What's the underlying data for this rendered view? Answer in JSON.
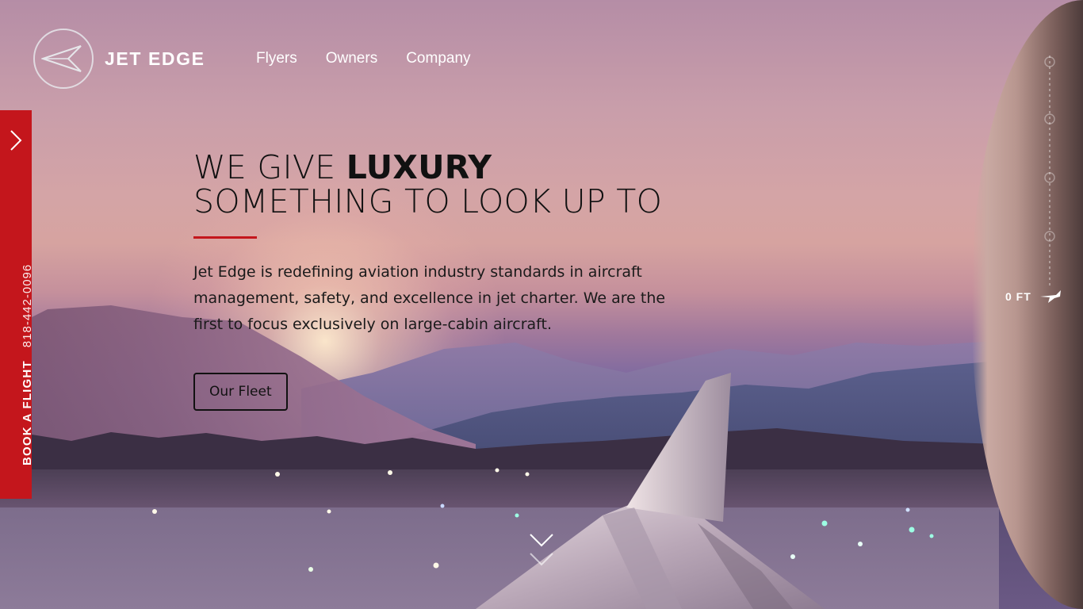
{
  "brand": {
    "name": "JET EDGE"
  },
  "nav": {
    "items": [
      "Flyers",
      "Owners",
      "Company"
    ]
  },
  "side_tab": {
    "book_label": "BOOK A FLIGHT",
    "phone": "818-442-0096",
    "toggle_icon": "chevron-right-icon"
  },
  "hero": {
    "headline_part1": "WE GIVE ",
    "headline_strong": "LUXURY",
    "headline_line2": "SOMETHING TO LOOK UP TO",
    "body": "Jet Edge is redefining aviation industry standards in aircraft management, safety, and excellence in jet charter. We are the first to focus exclusively on large-cabin aircraft.",
    "button_label": "Our Fleet"
  },
  "altitude": {
    "label": "0 FT"
  },
  "colors": {
    "accent": "#c4161c",
    "text_dark": "#111111",
    "nav_text": "#ffffff"
  }
}
